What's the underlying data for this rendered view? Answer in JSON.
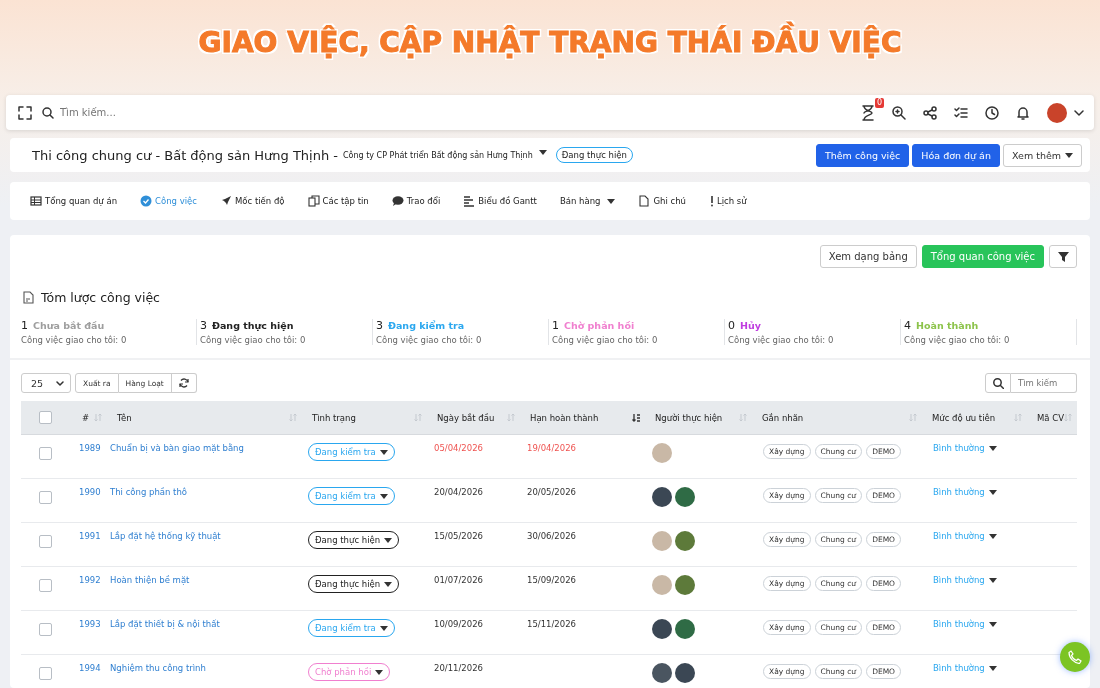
{
  "banner": {
    "title": "GIAO VIỆC, CẬP NHẬT TRẠNG THÁI ĐẦU VIỆC"
  },
  "topbar": {
    "search_placeholder": "Tìm kiếm...",
    "notification_badge": "0"
  },
  "project": {
    "title": "Thi công chung cư - Bất động sản Hưng Thịnh -",
    "company": "Công ty CP Phát triển Bất động sản Hưng Thịnh",
    "status": "Đang thực hiện",
    "buttons": [
      {
        "label": "Thêm công việc",
        "kind": "primary"
      },
      {
        "label": "Hóa đơn dự án",
        "kind": "primary"
      },
      {
        "label": "Xem thêm",
        "kind": "dropdown"
      }
    ]
  },
  "tabs": [
    {
      "label": "Tổng quan dự án",
      "kind": "table",
      "selected": false,
      "dropdown": false
    },
    {
      "label": "Công việc",
      "kind": "check",
      "selected": true,
      "dropdown": false
    },
    {
      "label": "Mốc tiến độ",
      "kind": "rocket",
      "selected": false,
      "dropdown": false
    },
    {
      "label": "Các tập tin",
      "kind": "files",
      "selected": false,
      "dropdown": false
    },
    {
      "label": "Trao đổi",
      "kind": "chat",
      "selected": false,
      "dropdown": false
    },
    {
      "label": "Biểu đồ Gantt",
      "kind": "gantt",
      "selected": false,
      "dropdown": false
    },
    {
      "label": "Bán hàng",
      "kind": "menu",
      "selected": false,
      "dropdown": true
    },
    {
      "label": "Ghi chú",
      "kind": "file",
      "selected": false,
      "dropdown": false
    },
    {
      "label": "Lịch sử",
      "kind": "excl",
      "selected": false,
      "dropdown": false
    }
  ],
  "view_buttons": [
    {
      "label": "Xem dạng bảng",
      "kind": "outline"
    },
    {
      "label": "Tổng quan công việc",
      "kind": "success"
    }
  ],
  "summary": {
    "title": "Tóm lược công việc",
    "items": [
      {
        "count": "1",
        "label": "Chưa bắt đầu",
        "color": "#9e9e9e",
        "note": "Công việc giao cho tôi: 0"
      },
      {
        "count": "3",
        "label": "Đang thực hiện",
        "color": "#222222",
        "note": "Công việc giao cho tôi: 0"
      },
      {
        "count": "3",
        "label": "Đang kiểm tra",
        "color": "#2aa7ef",
        "note": "Công việc giao cho tôi: 0"
      },
      {
        "count": "1",
        "label": "Chờ phản hồi",
        "color": "#f07fcf",
        "note": "Công việc giao cho tôi: 0"
      },
      {
        "count": "0",
        "label": "Hủy",
        "color": "#c03de0",
        "note": "Công việc giao cho tôi: 0"
      },
      {
        "count": "4",
        "label": "Hoàn thành",
        "color": "#8cc34a",
        "note": "Công việc giao cho tôi: 0"
      }
    ]
  },
  "toolbar": {
    "page_size": "25",
    "buttons": [
      "Xuất ra",
      "Hàng Loạt"
    ],
    "search_placeholder": "Tìm kiếm"
  },
  "table": {
    "select_all": {
      "checked": false
    },
    "columns": [
      {
        "label": "#",
        "kind": "sortable"
      },
      {
        "label": "Tên",
        "kind": "sortable"
      },
      {
        "label": "Tình trạng",
        "kind": "sortable"
      },
      {
        "label": "Ngày bắt đầu",
        "kind": "sortable"
      },
      {
        "label": "Hạn hoàn thành",
        "kind": "sorted"
      },
      {
        "label": "Người thực hiện",
        "kind": "sortable"
      },
      {
        "label": "Gắn nhãn",
        "kind": "sortable"
      },
      {
        "label": "Mức độ ưu tiên",
        "kind": "sortable"
      },
      {
        "label": "Mã CV",
        "kind": "sortable"
      }
    ],
    "rows": [
      {
        "checked": false,
        "id": "1989",
        "name": "Chuẩn bị và bàn giao mặt bằng",
        "status": {
          "text": "Đang kiểm tra",
          "color": "#2aa7ef"
        },
        "start": "05/04/2026",
        "due": "19/04/2026",
        "overdue": true,
        "assignees": [
          {
            "color": "#c9b8a6"
          }
        ],
        "tags": [
          "Xây dựng",
          "Chung cư",
          "DEMO"
        ],
        "priority": "Bình thường"
      },
      {
        "checked": false,
        "id": "1990",
        "name": "Thi công phần thô",
        "status": {
          "text": "Đang kiểm tra",
          "color": "#2aa7ef"
        },
        "start": "20/04/2026",
        "due": "20/05/2026",
        "overdue": false,
        "assignees": [
          {
            "color": "#3b4754"
          },
          {
            "color": "#2f6b45"
          }
        ],
        "tags": [
          "Xây dựng",
          "Chung cư",
          "DEMO"
        ],
        "priority": "Bình thường"
      },
      {
        "checked": false,
        "id": "1991",
        "name": "Lắp đặt hệ thống kỹ thuật",
        "status": {
          "text": "Đang thực hiện",
          "color": "#222222"
        },
        "start": "15/05/2026",
        "due": "30/06/2026",
        "overdue": false,
        "assignees": [
          {
            "color": "#c9b8a6"
          },
          {
            "color": "#5d7a3a"
          }
        ],
        "tags": [
          "Xây dựng",
          "Chung cư",
          "DEMO"
        ],
        "priority": "Bình thường"
      },
      {
        "checked": false,
        "id": "1992",
        "name": "Hoàn thiện bề mặt",
        "status": {
          "text": "Đang thực hiện",
          "color": "#222222"
        },
        "start": "01/07/2026",
        "due": "15/09/2026",
        "overdue": false,
        "assignees": [
          {
            "color": "#c9b8a6"
          },
          {
            "color": "#5d7a3a"
          }
        ],
        "tags": [
          "Xây dựng",
          "Chung cư",
          "DEMO"
        ],
        "priority": "Bình thường"
      },
      {
        "checked": false,
        "id": "1993",
        "name": "Lắp đặt thiết bị & nội thất",
        "status": {
          "text": "Đang kiểm tra",
          "color": "#2aa7ef"
        },
        "start": "10/09/2026",
        "due": "15/11/2026",
        "overdue": false,
        "assignees": [
          {
            "color": "#3b4754"
          },
          {
            "color": "#2f6b45"
          }
        ],
        "tags": [
          "Xây dựng",
          "Chung cư",
          "DEMO"
        ],
        "priority": "Bình thường"
      },
      {
        "checked": false,
        "id": "1994",
        "name": "Nghiệm thu công trình",
        "status": {
          "text": "Chờ phản hồi",
          "color": "#f07fcf"
        },
        "start": "20/11/2026",
        "overdue": false,
        "assignees": [
          {
            "color": "#4a5560"
          },
          {
            "color": "#3b4754"
          }
        ],
        "tags": [
          "Xây dựng",
          "Chung cư",
          "DEMO"
        ],
        "priority": "Bình thường"
      }
    ]
  }
}
